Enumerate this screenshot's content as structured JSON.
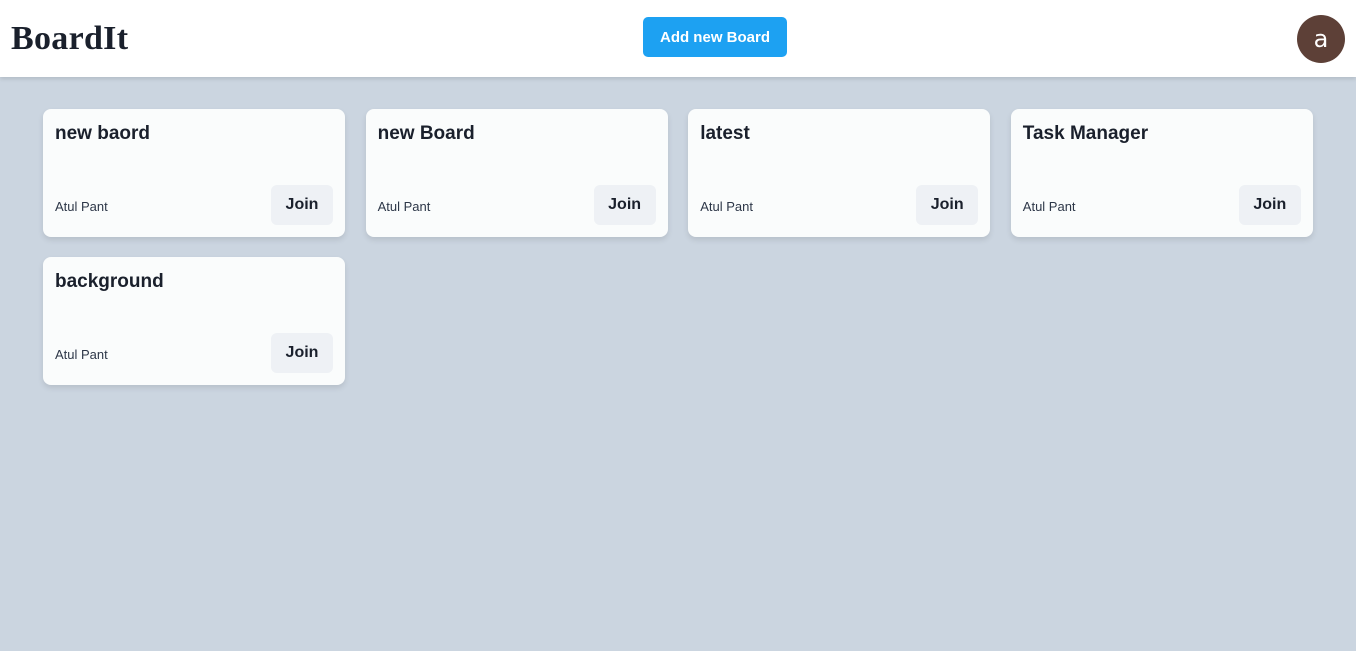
{
  "navbar": {
    "brand": "BoardIt",
    "add_button_label": "Add new Board",
    "avatar_initial": "a",
    "avatar_color": "#5d4037",
    "accent_color": "#1da1f2"
  },
  "boards": [
    {
      "title": "new baord",
      "owner": "Atul Pant",
      "join_label": "Join"
    },
    {
      "title": "new Board",
      "owner": "Atul Pant",
      "join_label": "Join"
    },
    {
      "title": "latest",
      "owner": "Atul Pant",
      "join_label": "Join"
    },
    {
      "title": "Task Manager",
      "owner": "Atul Pant",
      "join_label": "Join"
    },
    {
      "title": "background",
      "owner": "Atul Pant",
      "join_label": "Join"
    }
  ]
}
